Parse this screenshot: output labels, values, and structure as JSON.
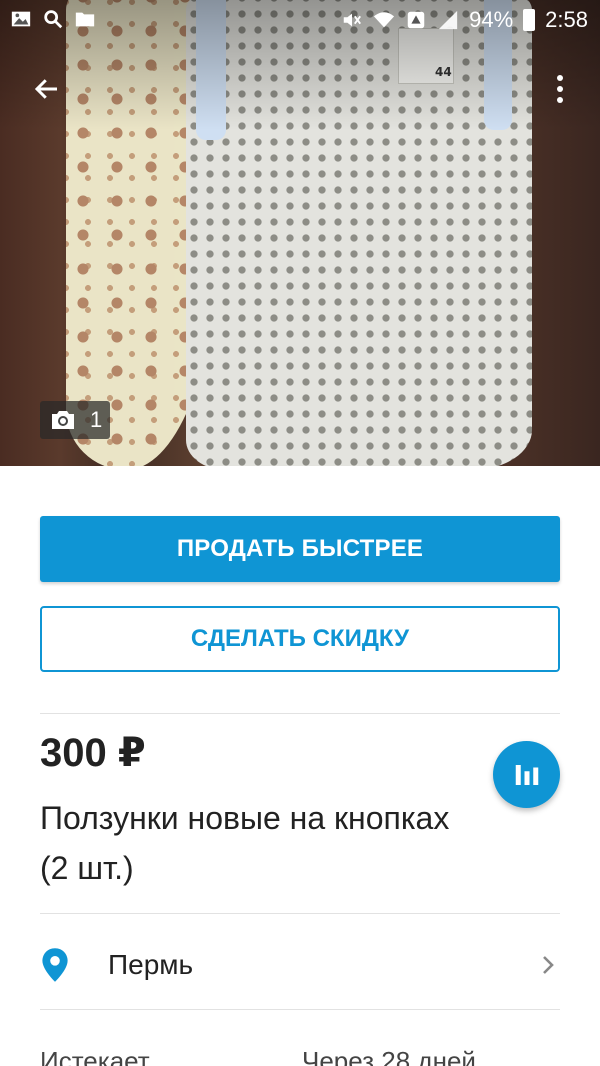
{
  "status_bar": {
    "battery": "94%",
    "time": "2:58",
    "icons": [
      "gallery-icon",
      "search-icon",
      "folder-icon",
      "mute-icon",
      "wifi-icon",
      "data-icon",
      "signal-icon",
      "battery-icon"
    ]
  },
  "app_bar": {
    "back_icon": "arrow-left-icon",
    "menu_icon": "more-vertical-icon"
  },
  "photo": {
    "count": "1",
    "tag_text": "44",
    "count_icon": "camera-icon"
  },
  "actions": {
    "primary_label": "ПРОДАТЬ БЫСТРЕЕ",
    "secondary_label": "СДЕЛАТЬ СКИДКУ"
  },
  "listing": {
    "price": "300 ₽",
    "title": "Ползунки новые на кнопках (2 шт.)",
    "stats_icon": "bar-chart-icon"
  },
  "location": {
    "city": "Пермь",
    "pin_icon": "location-pin-icon",
    "chevron_icon": "chevron-right-icon"
  },
  "footer": {
    "label": "Истекает",
    "value": "Через 28 дней"
  },
  "colors": {
    "accent": "#0f95d4",
    "text": "#222222",
    "divider": "#e2e2e2"
  }
}
